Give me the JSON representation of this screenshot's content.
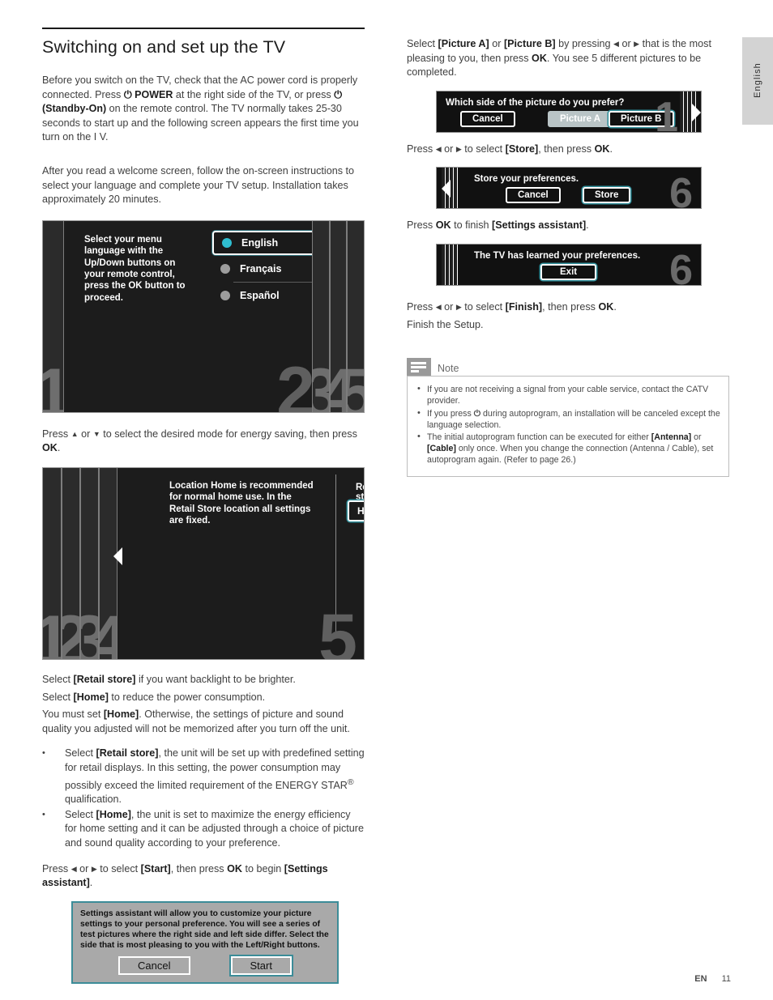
{
  "page": {
    "title": "Switching on and set up the TV",
    "language_tab": "English",
    "footer": {
      "locale": "EN",
      "page_number": "11"
    }
  },
  "left_column": {
    "paragraphs": [
      "Before you switch on the TV, check that the AC power cord is properly connected. Press ⏻ POWER at the right side of the TV, or press ⏻ (Standby-On) on the remote control. The TV normally takes 25-30 seconds to start up and the following screen appears the first time you turn on the I V.",
      "After you read a welcome screen, follow the on-screen instructions to select your language and complete your TV setup.  Installation takes approximately 20 minutes."
    ],
    "language_screen": {
      "instruction": "Select your menu language with the Up/Down buttons on your remote control, press the OK button to proceed.",
      "options": [
        {
          "label": "English",
          "selected": true
        },
        {
          "label": "Français",
          "selected": false
        },
        {
          "label": "Español",
          "selected": false
        }
      ],
      "step_numbers": [
        "1",
        "2",
        "3",
        "4",
        "5"
      ]
    },
    "caption_energy": "Press ▲ or ▼ to select the desired mode for energy saving, then press OK.",
    "location_screen": {
      "instruction": "Location Home is recommended for normal home use. In the Retail Store location all settings are fixed.",
      "heading": "Retail store",
      "button": "Home",
      "step_numbers": [
        "1",
        "2",
        "3",
        "4",
        "5"
      ]
    },
    "after_text": [
      "Select [Retail store] if you want backlight to be brighter.",
      "Select [Home] to reduce the power consumption.",
      "You must set [Home]. Otherwise, the settings of picture and sound quality you adjusted will not be memorized after you turn off the unit."
    ],
    "bullets": [
      "Select [Retail store], the unit will be set up with predefined setting for retail displays. In this setting, the power consumption may possibly exceed the limited requirement of the ENERGY STAR® qualification.",
      "Select [Home], the unit is set to maximize the energy efficiency for home setting and it can be adjusted through a choice of picture and sound quality according to your preference."
    ],
    "caption_start": "Press ◀ or ▶ to select [Start], then press OK to begin [Settings assistant].",
    "settings_assistant_dialog": {
      "message": "Settings assistant will allow you to customize your picture settings to your personal preference. You will see a series of test pictures where the right side and left side differ. Select the side that is most pleasing to you with the Left/Right buttons.",
      "cancel_label": "Cancel",
      "start_label": "Start"
    }
  },
  "right_column": {
    "intro": "Select [Picture A] or [Picture B] by pressing ◀ or ▶ that is the most pleasing to you, then press OK. You see 5 different pictures to be completed.",
    "picture_dialog": {
      "title": "Which side of the picture do you prefer?",
      "cancel_label": "Cancel",
      "picture_a_label": "Picture A",
      "picture_b_label": "Picture B",
      "step_number": "1"
    },
    "caption_store": "Press ◀ or ▶ to select [Store], then press OK.",
    "store_dialog": {
      "title": "Store your preferences.",
      "cancel_label": "Cancel",
      "store_label": "Store",
      "step_number": "6"
    },
    "caption_finish_assistant": "Press OK to finish [Settings assistant].",
    "learned_dialog": {
      "title": "The TV has learned your preferences.",
      "exit_label": "Exit",
      "step_number": "6"
    },
    "caption_finish": "Press ◀ or ▶ to select [Finish], then press OK.",
    "caption_finish_setup": "Finish the Setup.",
    "note": {
      "title": "Note",
      "items": [
        "If you are not receiving a signal from your cable service, contact the CATV provider.",
        "If you press ⏻ during autoprogram, an installation will be canceled except the language selection.",
        "The initial autoprogram function can be executed for either [Antenna] or [Cable] only once. When you change the connection (Antenna / Cable), set autoprogram again. (Refer to page 26.)"
      ]
    }
  },
  "colors": {
    "accent_teal": "#2fbed0",
    "focus_teal": "#3c8c98",
    "screen_dark": "#1c1c1c",
    "tab_gray": "#d3d3d3"
  }
}
